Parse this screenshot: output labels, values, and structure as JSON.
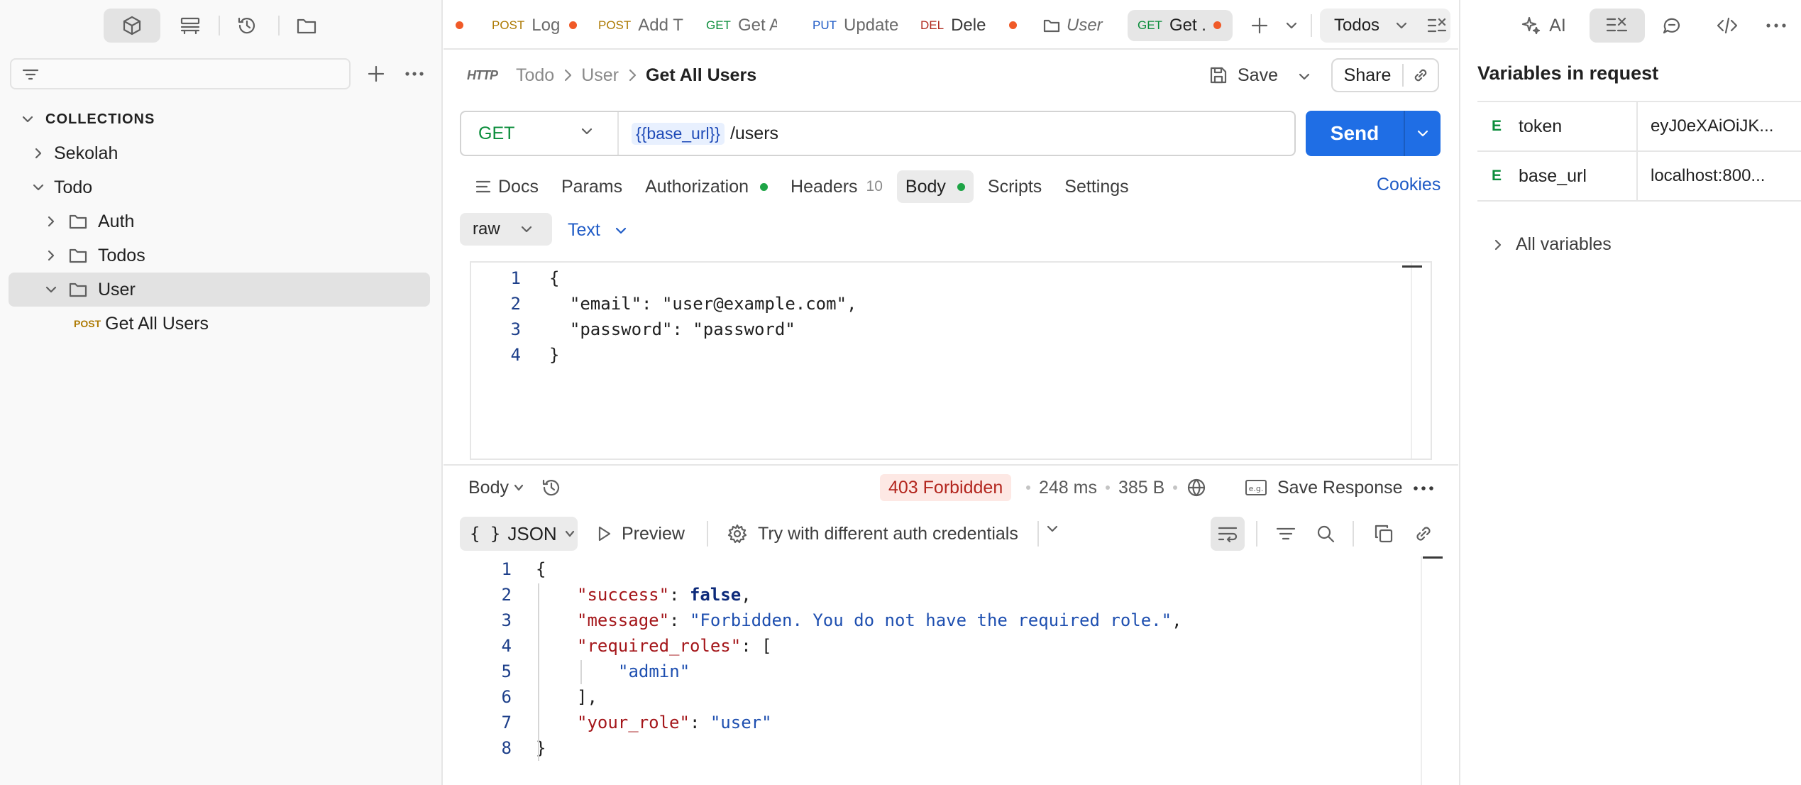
{
  "sidebar": {
    "filter_placeholder": "",
    "collections_label": "COLLECTIONS",
    "tree": {
      "sekolah": "Sekolah",
      "todo": "Todo",
      "auth": "Auth",
      "todos": "Todos",
      "user": "User",
      "get_all_users_method": "POST",
      "get_all_users": "Get All Users"
    }
  },
  "tabs": [
    {
      "method": "",
      "label": "",
      "unsaved": true
    },
    {
      "method": "POST",
      "label": "Log",
      "unsaved": true
    },
    {
      "method": "POST",
      "label": "Add T",
      "unsaved": false
    },
    {
      "method": "GET",
      "label": "Get All",
      "unsaved": false
    },
    {
      "method": "PUT",
      "label": "Update",
      "unsaved": false
    },
    {
      "method": "DEL",
      "label": "Dele",
      "unsaved": true
    },
    {
      "method": "",
      "label": "User",
      "unsaved": false
    },
    {
      "method": "GET",
      "label": "Get .",
      "unsaved": true
    }
  ],
  "environment": "Todos",
  "request": {
    "breadcrumb": {
      "collection": "Todo",
      "folder": "User",
      "current": "Get All Users",
      "icon_text": "HTTP"
    },
    "save_label": "Save",
    "share_label": "Share",
    "method": "GET",
    "url_var": "{{base_url}}",
    "url_path": "/users",
    "send_label": "Send",
    "tabs": {
      "docs": "Docs",
      "params": "Params",
      "authorization": "Authorization",
      "headers": "Headers",
      "headers_count": "10",
      "body": "Body",
      "scripts": "Scripts",
      "settings": "Settings"
    },
    "cookies_label": "Cookies",
    "body_mode": "raw",
    "body_type": "Text",
    "body_lines": [
      "{",
      "  \"email\": \"user@example.com\",",
      "  \"password\": \"password\"",
      "}"
    ]
  },
  "response": {
    "view_label": "Body",
    "status": "403 Forbidden",
    "time": "248 ms",
    "size": "385 B",
    "save_response_label": "Save Response",
    "format": "JSON",
    "preview_label": "Preview",
    "try_auth_label": "Try with different auth credentials",
    "json": {
      "success_key": "\"success\"",
      "success_val": "false",
      "message_key": "\"message\"",
      "message_val": "\"Forbidden. You do not have the required role.\"",
      "roles_key": "\"required_roles\"",
      "role_0": "\"admin\"",
      "your_role_key": "\"your_role\"",
      "your_role_val": "\"user\""
    }
  },
  "right_panel": {
    "ai_label": "AI",
    "title": "Variables in request",
    "variables": [
      {
        "scope": "E",
        "name": "token",
        "value": "eyJ0eXAiOiJK..."
      },
      {
        "scope": "E",
        "name": "base_url",
        "value": "localhost:800..."
      }
    ],
    "all_variables_label": "All variables"
  },
  "colors": {
    "accent": "#1f6ee5",
    "get": "#0b8d3b",
    "post": "#ad7a03",
    "put": "#1f5bc6",
    "delete": "#b02a1f",
    "error_badge_bg": "#fde8e4",
    "error_badge_text": "#b3261e",
    "unsaved_dot": "#f05a28"
  }
}
